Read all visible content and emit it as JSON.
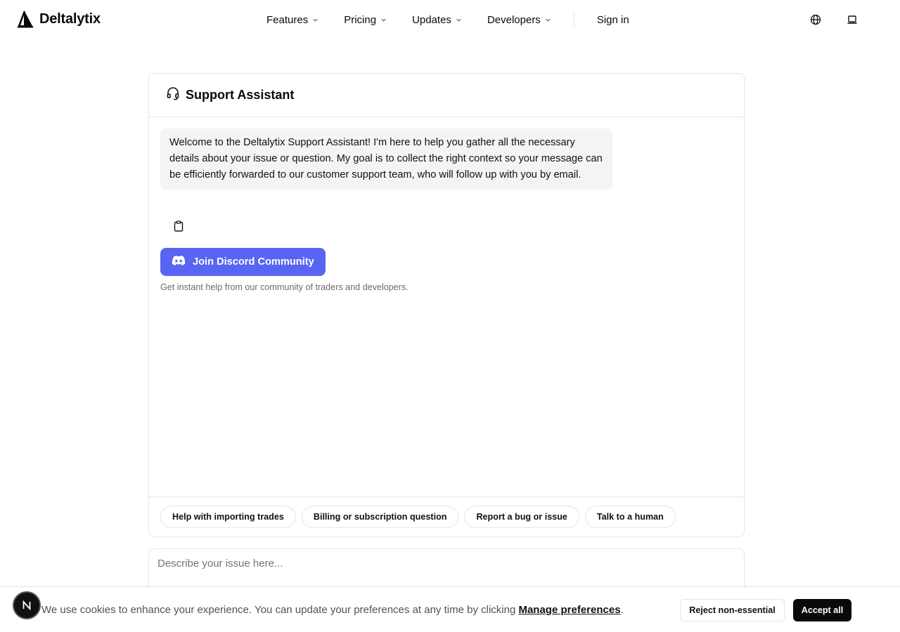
{
  "header": {
    "brand": "Deltalytix",
    "nav": [
      {
        "label": "Features"
      },
      {
        "label": "Pricing"
      },
      {
        "label": "Updates"
      },
      {
        "label": "Developers"
      }
    ],
    "signin_label": "Sign in",
    "icons": [
      "logo-icon",
      "globe-icon",
      "laptop-icon"
    ]
  },
  "chat": {
    "title": "Support Assistant",
    "title_icon": "headset-icon",
    "welcome_message": "Welcome to the Deltalytix Support Assistant! I'm here to help you gather all the necessary details about your issue or question. My goal is to collect the right context so your message can be efficiently forwarded to our customer support team, who will follow up with you by email.",
    "copy_icon": "clipboard-icon",
    "discord_button_label": "Join Discord Community",
    "discord_subtext": "Get instant help from our community of traders and developers.",
    "quick_replies": [
      "Help with importing trades",
      "Billing or subscription question",
      "Report a bug or issue",
      "Talk to a human"
    ],
    "input_placeholder": "Describe your issue here..."
  },
  "cookie_banner": {
    "text": "We use cookies to enhance your experience. You can update your preferences at any time by clicking ",
    "link_label": "Manage preferences",
    "text_end": ".",
    "reject_label": "Reject non-essential",
    "accept_label": "Accept all"
  },
  "colors": {
    "discord": "#5865f2",
    "bubble": "#f4f4f5",
    "accent_dark": "#0a0a0a"
  }
}
